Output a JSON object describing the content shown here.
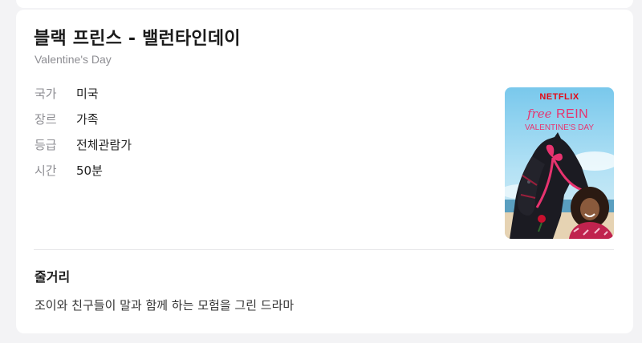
{
  "show": {
    "title": "블랙 프린스 - 밸런타인데이",
    "original_title": "Valentine's Day"
  },
  "details": [
    {
      "label": "국가",
      "value": "미국"
    },
    {
      "label": "장르",
      "value": "가족"
    },
    {
      "label": "등급",
      "value": "전체관람가"
    },
    {
      "label": "시간",
      "value": "50분"
    }
  ],
  "poster": {
    "brand": "NETFLIX",
    "logo_script": "free",
    "logo_word": "REIN",
    "tagline": "VALENTINE'S DAY"
  },
  "synopsis": {
    "heading": "줄거리",
    "text": "조이와 친구들이 말과 함께 하는 모험을 그린 드라마"
  },
  "colors": {
    "page_background": "#f3f3f5",
    "card_background": "#ffffff",
    "label_gray": "#8e8e93",
    "brand_red": "#e50914",
    "accent_pink": "#e8336f"
  }
}
